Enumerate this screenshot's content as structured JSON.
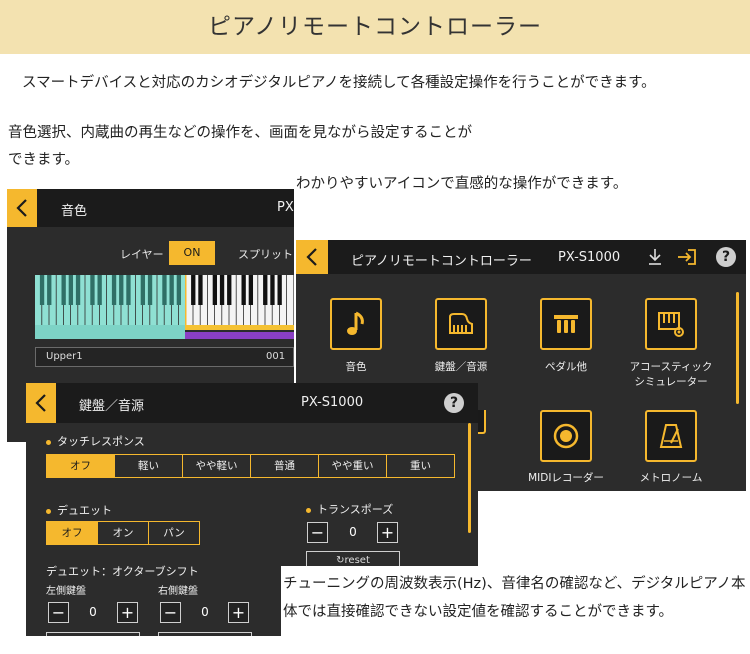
{
  "banner": {
    "title": "ピアノリモートコントローラー"
  },
  "intro": "スマートデバイスと対応のカシオデジタルピアノを接続して各種設定操作を行うことができます。",
  "desc1": "音色選択、内蔵曲の再生などの操作を、画面を見ながら設定することができます。",
  "desc2": "わかりやすいアイコンで直感的な操作ができます。",
  "desc3": "チューニングの周波数表示(Hz)、音律名の確認など、デジタルピアノ本体では直接確認できない設定値を確認することができます。",
  "tone_screen": {
    "title": "音色",
    "model": "PX",
    "layer_label": "レイヤー",
    "layer_state": "ON",
    "split_label": "スプリット",
    "upper_label": "Upper1",
    "upper_value": "001"
  },
  "main_screen": {
    "title": "ピアノリモートコントローラー",
    "model": "PX-S1000",
    "help": "?",
    "items": [
      {
        "label": "音色",
        "icon": "music-note-icon"
      },
      {
        "label": "鍵盤／音源",
        "icon": "grand-piano-icon"
      },
      {
        "label": "ペダル他",
        "icon": "pedal-icon"
      },
      {
        "label": "アコースティック\nシミュレーター",
        "icon": "acoustic-simulator-icon"
      },
      {
        "label": "MIDIレコーダー",
        "icon": "record-icon"
      },
      {
        "label": "メトロノーム",
        "icon": "metronome-icon"
      }
    ]
  },
  "keyboard_screen": {
    "title": "鍵盤／音源",
    "model": "PX-S1000",
    "help": "?",
    "touch_response": {
      "label": "タッチレスポンス",
      "options": [
        "オフ",
        "軽い",
        "やや軽い",
        "普通",
        "やや重い",
        "重い"
      ],
      "selected": 0
    },
    "duet": {
      "label": "デュエット",
      "options": [
        "オフ",
        "オン",
        "パン"
      ],
      "selected": 0
    },
    "transpose": {
      "label": "トランスポーズ",
      "value": "0",
      "reset": "reset"
    },
    "octave_shift": {
      "label": "デュエット：オクターブシフト",
      "left_label": "左側鍵盤",
      "left_value": "0",
      "right_label": "右側鍵盤",
      "right_value": "0"
    }
  }
}
